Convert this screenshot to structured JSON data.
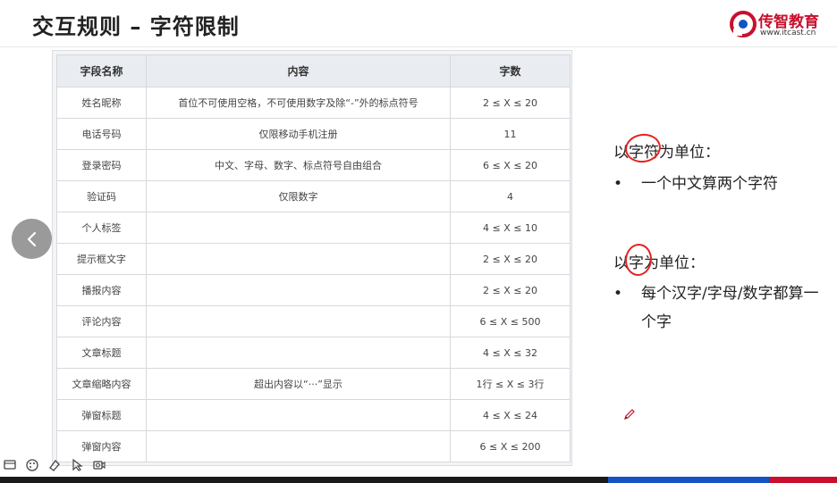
{
  "slide": {
    "title": "交互规则 – 字符限制"
  },
  "logo": {
    "name": "传智教育",
    "url": "www.itcast.cn",
    "brand_color": "#c8102e"
  },
  "table": {
    "headers": [
      "字段名称",
      "内容",
      "字数"
    ],
    "rows": [
      {
        "field": "姓名昵称",
        "content": "首位不可使用空格，不可使用数字及除“-”外的标点符号",
        "count": "2 ≤ X ≤ 20"
      },
      {
        "field": "电话号码",
        "content": "仅限移动手机注册",
        "count": "11"
      },
      {
        "field": "登录密码",
        "content": "中文、字母、数字、标点符号自由组合",
        "count": "6 ≤ X ≤ 20"
      },
      {
        "field": "验证码",
        "content": "仅限数字",
        "count": "4"
      },
      {
        "field": "个人标签",
        "content": "",
        "count": "4 ≤ X ≤ 10"
      },
      {
        "field": "提示框文字",
        "content": "",
        "count": "2 ≤ X ≤ 20"
      },
      {
        "field": "播报内容",
        "content": "",
        "count": "2 ≤ X ≤ 20"
      },
      {
        "field": "评论内容",
        "content": "",
        "count": "6 ≤ X ≤ 500"
      },
      {
        "field": "文章标题",
        "content": "",
        "count": "4 ≤ X ≤ 32"
      },
      {
        "field": "文章缩略内容",
        "content": "超出内容以“···”显示",
        "count": "1行 ≤ X ≤ 3行"
      },
      {
        "field": "弹窗标题",
        "content": "",
        "count": "4 ≤ X ≤ 24"
      },
      {
        "field": "弹窗内容",
        "content": "",
        "count": "6 ≤ X ≤ 200"
      }
    ]
  },
  "notes": {
    "rule1": {
      "heading": "以字符为单位：",
      "bullet": "一个中文算两个字符"
    },
    "rule2": {
      "heading": "以字为单位：",
      "bullet_line1": "每个汉字/字母/数字都算一",
      "bullet_line2": "个字"
    },
    "bullet_symbol": "•"
  },
  "colors": {
    "annotation": "#e52222",
    "accent_blue": "#1552c2"
  },
  "icons": [
    "chevron-left-icon",
    "screen-icon",
    "palette-icon",
    "eraser-icon",
    "pointer-icon",
    "camera-icon",
    "pen-icon"
  ]
}
